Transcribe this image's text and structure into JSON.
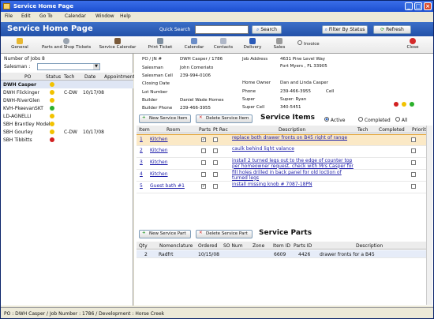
{
  "window": {
    "title": "Service Home Page",
    "min": "_",
    "max": "□",
    "close": "×"
  },
  "menu": [
    "File",
    "Edit",
    "Go To",
    "Calendar",
    "Window",
    "Help"
  ],
  "banner": {
    "title": "Service Home Page",
    "quick_search_label": "Quick Search",
    "search_value": "",
    "search_btn": "Search",
    "filter_btn": "Filter By Status",
    "refresh_btn": "Refresh"
  },
  "toolbar": {
    "general": "General",
    "parts": "Parts and Shop Tickets",
    "service_calendar": "Service Calendar",
    "print_ticket": "Print Ticket",
    "calendar": "Calendar",
    "contacts": "Contacts",
    "delivery": "Delivery",
    "sales": "Sales",
    "invoice": "Invoice",
    "close": "Close"
  },
  "left": {
    "num_jobs_label": "Number of Jobs",
    "num_jobs": "8",
    "salesman_label": "Salesman :",
    "salesman_value": "",
    "headers": {
      "po": "PO",
      "status": "Status",
      "tech": "Tech",
      "date": "Date",
      "appointment": "Appointment"
    },
    "jobs": [
      {
        "po": "DWH Casper",
        "status": "yellow",
        "tech": "",
        "date": ""
      },
      {
        "po": "DWH Flickinger",
        "status": "yellow",
        "tech": "C-DW",
        "date": "10/17/08"
      },
      {
        "po": "DWH-RiverGlen",
        "status": "yellow",
        "tech": "",
        "date": ""
      },
      {
        "po": "KVH-PkeevanSKT",
        "status": "green",
        "tech": "",
        "date": ""
      },
      {
        "po": "LD-AGNELLI",
        "status": "yellow",
        "tech": "",
        "date": ""
      },
      {
        "po": "SBH Brantley Model",
        "status": "yellow",
        "tech": "",
        "date": ""
      },
      {
        "po": "SBH Gourley",
        "status": "yellow",
        "tech": "C-DW",
        "date": "10/17/08"
      },
      {
        "po": "SBH Tibbitts",
        "status": "red",
        "tech": "",
        "date": ""
      }
    ]
  },
  "job_info": {
    "po_label": "PO / JN #",
    "po": "DWH Casper / 1786",
    "salesman_label": "Salesman",
    "salesman": "John Comeriato",
    "salesman_cell_label": "Salesman Cell",
    "salesman_cell": "239-994-0106",
    "closing_label": "Closing Date",
    "closing": "",
    "lot_label": "Lot Number",
    "lot": "",
    "builder_label": "Builder",
    "builder": "Daniel Wade Homes",
    "builder_phone_label": "Builder Phone",
    "builder_phone": "239-466-3955",
    "job_address_label": "Job Address",
    "job_address1": "4631 Pine Level Way",
    "job_address2": "Fort Myers , FL 33905",
    "home_owner_label": "Home Owner",
    "home_owner": "Dan and Linda Casper",
    "phone_label": "Phone",
    "phone": "239-466-3955",
    "cell_label": "Cell",
    "super_label": "Super",
    "super": "Super: Ryan",
    "super_cell_label": "Super Cell",
    "super_cell": "340-5451"
  },
  "service_items": {
    "title": "Service Items",
    "new_btn": "New Service Item",
    "delete_btn": "Delete Service Item",
    "filters": [
      "Active",
      "Completed",
      "All"
    ],
    "headers": {
      "item": "Item",
      "room": "Room",
      "parts": "Parts",
      "ptrec": "Pt Rec",
      "description": "Description",
      "tech": "Tech",
      "completed": "Completed",
      "priority": "Priority"
    },
    "rows": [
      {
        "item": "1",
        "room": "Kitchen",
        "parts": "✓",
        "description": "replace both drawer fronts on B45 right of range"
      },
      {
        "item": "2",
        "room": "Kitchen",
        "parts": "",
        "description": "caulk behind light valance"
      },
      {
        "item": "3",
        "room": "Kitchen",
        "parts": "",
        "description": "install 2 turned legs out to the edge of counter top per homeowner request. check with Mrs Casper for"
      },
      {
        "item": "4",
        "room": "Kitchen",
        "parts": "",
        "description": "fill holes drilled in back panel for old loction of turned legs"
      },
      {
        "item": "5",
        "room": "Guest bath #1",
        "parts": "✓",
        "description": "install missing knob # 7087-18PN"
      }
    ]
  },
  "service_parts": {
    "title": "Service Parts",
    "new_btn": "New Service Part",
    "delete_btn": "Delete Service Part",
    "headers": {
      "qty": "Qty",
      "nomenclature": "Nomenclature",
      "ordered": "Ordered",
      "so_num": "SO Num",
      "zone": "Zone",
      "item_id": "Item ID",
      "parts_id": "Parts ID",
      "description": "Description"
    },
    "rows": [
      {
        "qty": "2",
        "nomenclature": "Radfrt",
        "ordered": "10/15/08",
        "so_num": "",
        "zone": "",
        "item_id": "6609",
        "parts_id": "4426",
        "description": "drawer fronts for a B45"
      }
    ]
  },
  "status_bar": "PO : DWH Casper / Job Number : 1786 / Development : Horse Creek",
  "colors": {
    "banner": "#2f5fb9",
    "yellow": "#f2c200",
    "green": "#2bb02b",
    "red": "#d22020"
  }
}
